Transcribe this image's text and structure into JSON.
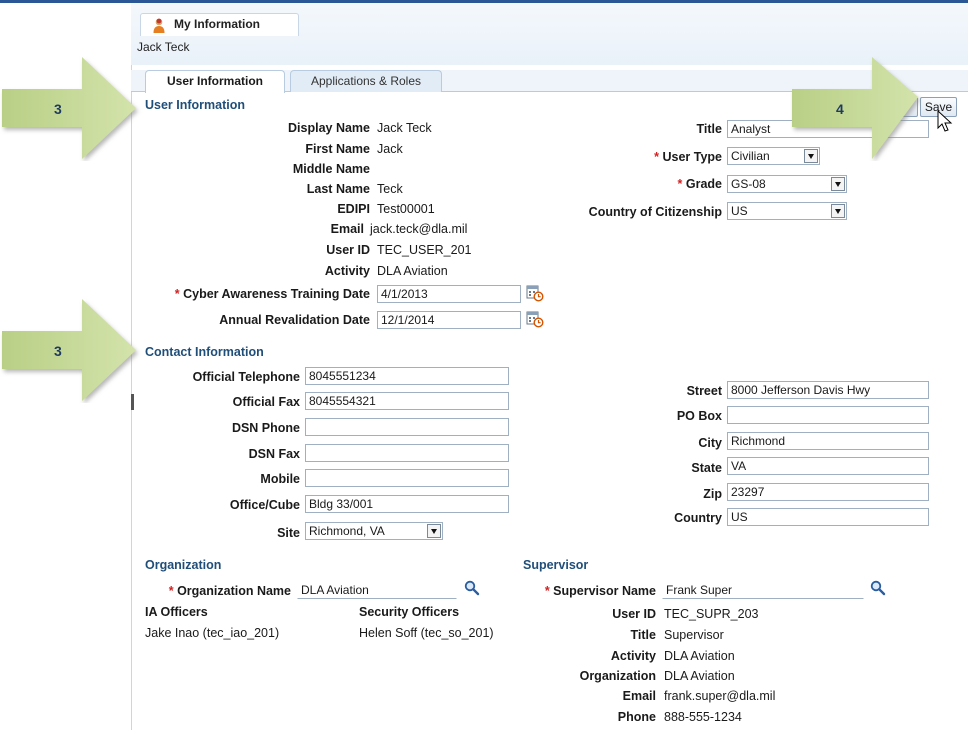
{
  "page": {
    "tab_label": "My Information",
    "user_name": "Jack Teck"
  },
  "tabs": [
    {
      "label": "User Information"
    },
    {
      "label": "Applications & Roles"
    }
  ],
  "user_info": {
    "section_title": "User Information",
    "display_name": {
      "label": "Display Name",
      "value": "Jack Teck"
    },
    "first_name": {
      "label": "First Name",
      "value": "Jack"
    },
    "middle_name": {
      "label": "Middle Name",
      "value": ""
    },
    "last_name": {
      "label": "Last Name",
      "value": "Teck"
    },
    "edipi": {
      "label": "EDIPI",
      "value": "Test00001"
    },
    "email": {
      "label": "Email",
      "value": "jack.teck@dla.mil"
    },
    "user_id": {
      "label": "User ID",
      "value": "TEC_USER_201"
    },
    "activity": {
      "label": "Activity",
      "value": "DLA Aviation"
    },
    "cyber_date": {
      "label": "Cyber Awareness Training Date",
      "value": "4/1/2013"
    },
    "annual_date": {
      "label": "Annual Revalidation Date",
      "value": "12/1/2014"
    },
    "title": {
      "label": "Title",
      "value": "Analyst"
    },
    "user_type": {
      "label": "User Type",
      "value": "Civilian"
    },
    "grade": {
      "label": "Grade",
      "value": "GS-08"
    },
    "country_citizenship": {
      "label": "Country of Citizenship",
      "value": "US"
    }
  },
  "buttons": {
    "cancel": "l",
    "save": "Save"
  },
  "contact": {
    "section_title": "Contact Information",
    "official_telephone": {
      "label": "Official Telephone",
      "value": "8045551234"
    },
    "official_fax": {
      "label": "Official Fax",
      "value": "8045554321"
    },
    "dsn_phone": {
      "label": "DSN Phone",
      "value": ""
    },
    "dsn_fax": {
      "label": "DSN Fax",
      "value": ""
    },
    "mobile": {
      "label": "Mobile",
      "value": ""
    },
    "office_cube": {
      "label": "Office/Cube",
      "value": "Bldg 33/001"
    },
    "site": {
      "label": "Site",
      "value": "Richmond, VA"
    },
    "street": {
      "label": "Street",
      "value": "8000 Jefferson Davis Hwy"
    },
    "po_box": {
      "label": "PO Box",
      "value": ""
    },
    "city": {
      "label": "City",
      "value": "Richmond"
    },
    "state": {
      "label": "State",
      "value": "VA"
    },
    "zip": {
      "label": "Zip",
      "value": "23297"
    },
    "country": {
      "label": "Country",
      "value": "US"
    }
  },
  "organization": {
    "section_title": "Organization",
    "name_label": "Organization Name",
    "name_value": "DLA Aviation",
    "ia_officers_label": "IA Officers",
    "ia_officers_value": "Jake Inao (tec_iao_201)",
    "security_officers_label": "Security Officers",
    "security_officers_value": "Helen Soff (tec_so_201)"
  },
  "supervisor": {
    "section_title": "Supervisor",
    "name_label": "Supervisor Name",
    "name_value": "Frank Super",
    "user_id": {
      "label": "User ID",
      "value": "TEC_SUPR_203"
    },
    "title": {
      "label": "Title",
      "value": "Supervisor"
    },
    "activity": {
      "label": "Activity",
      "value": "DLA Aviation"
    },
    "organization": {
      "label": "Organization",
      "value": "DLA Aviation"
    },
    "email": {
      "label": "Email",
      "value": "frank.super@dla.mil"
    },
    "phone": {
      "label": "Phone",
      "value": "888-555-1234"
    }
  },
  "callouts": [
    {
      "number": "3"
    },
    {
      "number": "4"
    },
    {
      "number": "3"
    }
  ],
  "required_marker": "*",
  "colors": {
    "section_title": "#1f4e79",
    "required": "#d32020",
    "callout_arrow": "#c5d89a",
    "top_bar": "#2b5797"
  }
}
